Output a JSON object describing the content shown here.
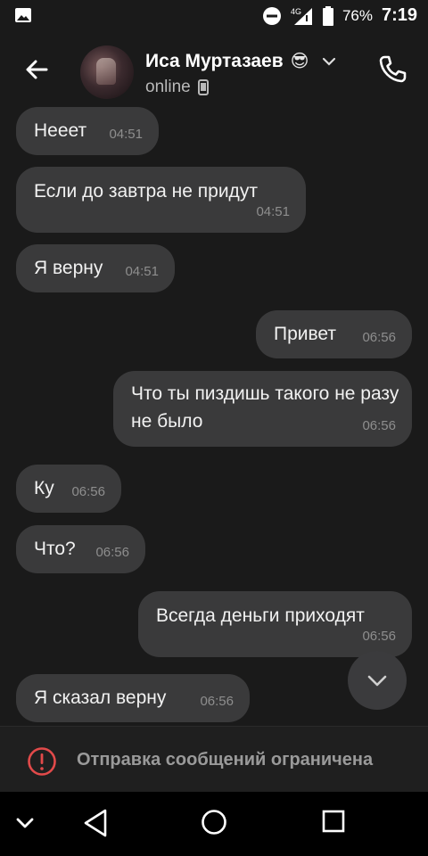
{
  "statusbar": {
    "battery": "76%",
    "time": "7:19",
    "network": "4G"
  },
  "header": {
    "contact_name": "Иса Муртазаев",
    "emoji": "😎",
    "status": "online"
  },
  "messages": [
    {
      "side": "in",
      "text": "Нееет",
      "time": "04:51"
    },
    {
      "side": "in",
      "text": "Если до завтра не придут",
      "time": "04:51"
    },
    {
      "side": "in",
      "text": "Я верну",
      "time": "04:51"
    },
    {
      "side": "out",
      "text": "Привет",
      "time": "06:56"
    },
    {
      "side": "out",
      "text": "Что ты пиздишь такого не разу не было",
      "time": "06:56"
    },
    {
      "side": "in",
      "text": "Ку",
      "time": "06:56"
    },
    {
      "side": "in",
      "text": "Что?",
      "time": "06:56"
    },
    {
      "side": "out",
      "text": "Всегда деньги приходят",
      "time": "06:56"
    },
    {
      "side": "in",
      "text": "Я сказал верну",
      "time": "06:56"
    }
  ],
  "footer": {
    "restriction_text": "Отправка сообщений ограничена"
  },
  "colors": {
    "bubble": "#3a3a3b",
    "background": "#1a1a1a",
    "warning": "#e24a4a"
  }
}
